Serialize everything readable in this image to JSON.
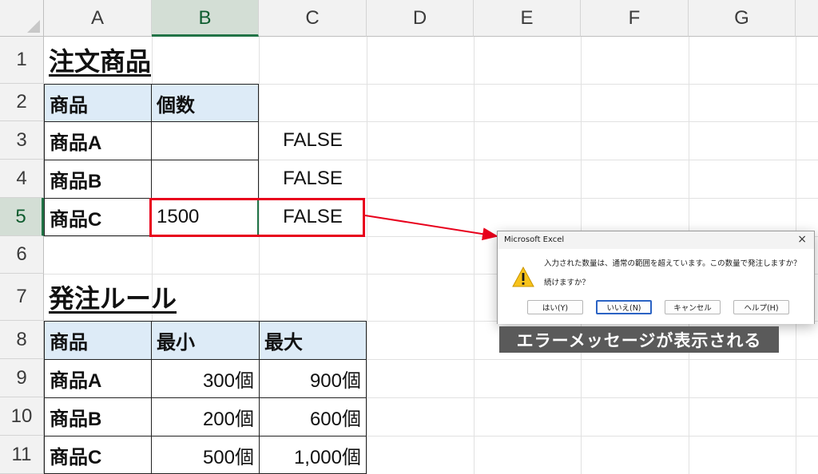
{
  "columns": [
    "A",
    "B",
    "C",
    "D",
    "E",
    "F",
    "G"
  ],
  "rows": [
    "1",
    "2",
    "3",
    "4",
    "5",
    "6",
    "7",
    "8",
    "9",
    "10",
    "11"
  ],
  "sheet": {
    "order_title": "注文商品",
    "order_header": {
      "product": "商品",
      "qty": "個数"
    },
    "order_rows": [
      {
        "product": "商品A",
        "qty": "",
        "result": "FALSE"
      },
      {
        "product": "商品B",
        "qty": "",
        "result": "FALSE"
      },
      {
        "product": "商品C",
        "qty": "1500",
        "result": "FALSE"
      }
    ],
    "rule_title": "発注ルール",
    "rule_header": {
      "product": "商品",
      "min": "最小",
      "max": "最大"
    },
    "rule_rows": [
      {
        "product": "商品A",
        "min": "300個",
        "max": "900個"
      },
      {
        "product": "商品B",
        "min": "200個",
        "max": "600個"
      },
      {
        "product": "商品C",
        "min": "500個",
        "max": "1,000個"
      }
    ]
  },
  "dialog": {
    "title": "Microsoft Excel",
    "close": "×",
    "message": "入力された数量は、通常の範囲を超えています。この数量で発注しますか？",
    "question": "続けますか？",
    "buttons": {
      "yes": "はい(Y)",
      "no": "いいえ(N)",
      "cancel": "キャンセル",
      "help": "ヘルプ(H)"
    }
  },
  "callout": "エラーメッセージが表示される",
  "colors": {
    "accent": "#217346",
    "highlight": "#e8001c",
    "header_fill": "#ddebf7"
  }
}
